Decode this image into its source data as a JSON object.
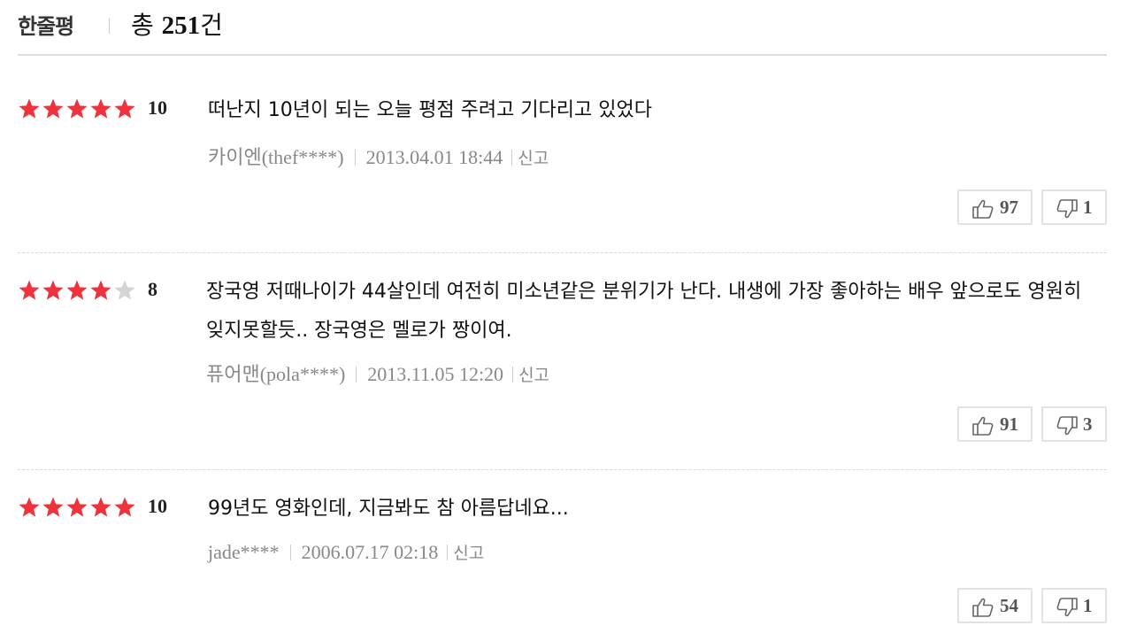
{
  "header": {
    "title": "한줄평",
    "total_prefix": "총",
    "total_count": "251",
    "total_suffix": "건"
  },
  "colors": {
    "star_on": "#f0323c",
    "star_off": "#d4d4d4"
  },
  "reviews": [
    {
      "rating_stars": 5,
      "score": "10",
      "comment": "떠난지 10년이 되는 오늘 평점 주려고 기다리고 있었다",
      "nick": "카이엔",
      "user_id": "(thef****)",
      "date": "2013.04.01 18:44",
      "report": "신고",
      "likes": "97",
      "dislikes": "1"
    },
    {
      "rating_stars": 4,
      "score": "8",
      "comment": "장국영 저때나이가 44살인데 여전히 미소년같은 분위기가 난다. 내생에 가장 좋아하는 배우 앞으로도 영원히 잊지못할듯.. 장국영은 멜로가 짱이여.",
      "nick": "퓨어맨",
      "user_id": "(pola****)",
      "date": "2013.11.05 12:20",
      "report": "신고",
      "likes": "91",
      "dislikes": "3"
    },
    {
      "rating_stars": 5,
      "score": "10",
      "comment": "99년도 영화인데, 지금봐도 참 아름답네요...",
      "nick": "",
      "user_id": "jade****",
      "date": "2006.07.17 02:18",
      "report": "신고",
      "likes": "54",
      "dislikes": "1"
    }
  ]
}
